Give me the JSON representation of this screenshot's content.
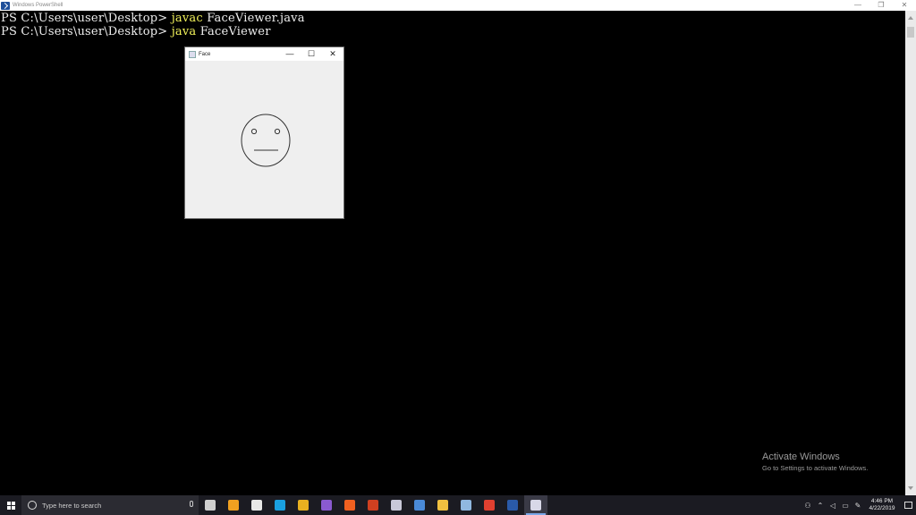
{
  "window": {
    "title": "Windows PowerShell",
    "controls": {
      "minimize": "—",
      "restore": "❐",
      "close": "✕"
    }
  },
  "console": {
    "lines": [
      {
        "prompt": "PS C:\\Users\\user\\Desktop> ",
        "command": "javac",
        "args": " FaceViewer.java"
      },
      {
        "prompt": "PS C:\\Users\\user\\Desktop> ",
        "command": "java",
        "args": " FaceViewer"
      }
    ],
    "colors": {
      "background": "#000000",
      "text": "#eeeeee",
      "command": "#f2f25a"
    }
  },
  "face_window": {
    "title": "Face",
    "controls": {
      "minimize": "—",
      "maximize": "☐",
      "close": "✕"
    }
  },
  "watermark": {
    "line1": "Activate Windows",
    "line2": "Go to Settings to activate Windows."
  },
  "taskbar": {
    "search_placeholder": "Type here to search",
    "apps": [
      {
        "name": "task-view-icon",
        "color": "#cfcfcf"
      },
      {
        "name": "edge-icon",
        "color": "#f0a020"
      },
      {
        "name": "store-icon",
        "color": "#e8e8e8"
      },
      {
        "name": "skype-icon",
        "color": "#1aa0e0"
      },
      {
        "name": "chrome-icon",
        "color": "#e8b020"
      },
      {
        "name": "visual-studio-icon",
        "color": "#8a5ad0"
      },
      {
        "name": "firefox-icon",
        "color": "#f06020"
      },
      {
        "name": "powerpoint-icon",
        "color": "#d04020"
      },
      {
        "name": "app-icon",
        "color": "#c8c8d8"
      },
      {
        "name": "app-blue-icon",
        "color": "#4a8ad8"
      },
      {
        "name": "file-explorer-icon",
        "color": "#f0c040"
      },
      {
        "name": "app-notes-icon",
        "color": "#90b8e0"
      },
      {
        "name": "chrome-2-icon",
        "color": "#e04030"
      },
      {
        "name": "powershell-icon",
        "color": "#2a5aa8"
      },
      {
        "name": "java-app-icon",
        "color": "#d8d8e8"
      }
    ],
    "clock": {
      "time": "4:46 PM",
      "date": "4/22/2019"
    }
  }
}
